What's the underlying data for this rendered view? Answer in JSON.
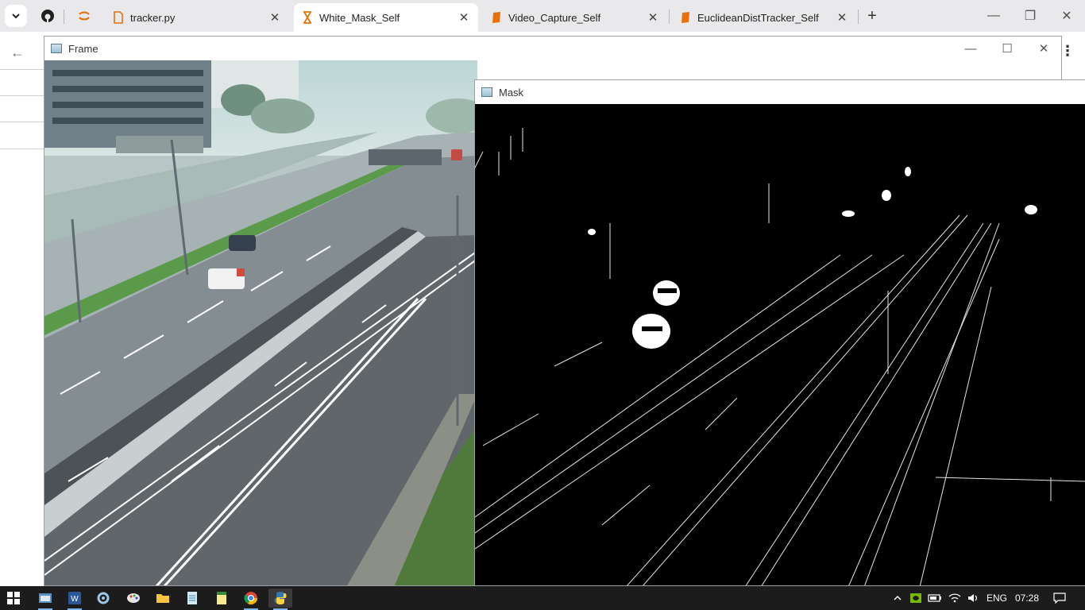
{
  "browser": {
    "tabs": [
      {
        "title": "tracker.py",
        "icon": "document-icon",
        "color": "#e8710a"
      },
      {
        "title": "White_Mask_Self",
        "icon": "hourglass-icon",
        "color": "#e8710a",
        "active": true
      },
      {
        "title": "Video_Capture_Self",
        "icon": "notebook-icon",
        "color": "#e8710a"
      },
      {
        "title": "EuclideanDistTracker_Self",
        "icon": "notebook-icon",
        "color": "#e8710a"
      }
    ],
    "close_glyph": "✕",
    "new_tab_glyph": "+",
    "window_controls": {
      "minimize": "—",
      "restore": "❐",
      "close": "✕"
    }
  },
  "frame_window": {
    "title": "Frame",
    "controls": {
      "minimize": "—",
      "maximize": "☐",
      "close": "✕"
    }
  },
  "mask_window": {
    "title": "Mask"
  },
  "taskbar": {
    "apps": [
      {
        "name": "start-button"
      },
      {
        "name": "file-explorer-app",
        "running": true
      },
      {
        "name": "word-app",
        "running": true
      },
      {
        "name": "settings-app"
      },
      {
        "name": "paint-app"
      },
      {
        "name": "folder-app"
      },
      {
        "name": "notepad-app"
      },
      {
        "name": "notes-app"
      },
      {
        "name": "chrome-app",
        "running": true
      },
      {
        "name": "python-app",
        "running": true,
        "active": true
      }
    ],
    "tray": {
      "language": "ENG",
      "time": "07:28"
    }
  },
  "colors": {
    "tab_strip": "#e9e9eb",
    "taskbar": "#1c1c1c",
    "accent_orange": "#e8710a"
  }
}
